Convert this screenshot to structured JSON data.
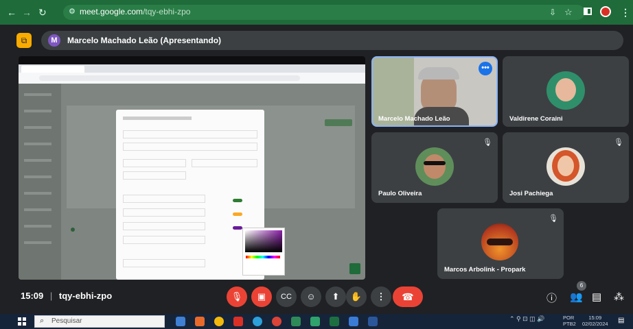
{
  "browser": {
    "url_host": "meet.google.com",
    "url_path": "/tqy-ebhi-zpo"
  },
  "header": {
    "presenter_initial": "M",
    "presenter_label": "Marcelo Machado Leão (Apresentando)"
  },
  "participants": [
    {
      "name": "Marcelo Machado Leão"
    },
    {
      "name": "Valdirene Coraini"
    },
    {
      "name": "Paulo Oliveira"
    },
    {
      "name": "Josi Pachiega"
    },
    {
      "name": "Marcos Arbolink - Propark"
    }
  ],
  "footer": {
    "time": "15:09",
    "separator": "|",
    "meeting_code": "tqy-ebhi-zpo",
    "participant_count": "6"
  },
  "taskbar": {
    "search_placeholder": "Pesquisar",
    "language": "POR",
    "language_sub": "PTB2",
    "clock_time": "15:09",
    "clock_date": "02/02/2024"
  },
  "colors": {
    "chrome_green": "#1f6b3a",
    "meet_bg": "#202124",
    "tile_bg": "#3c4043",
    "active_speaker": "#8ab4f8",
    "danger": "#ea4335",
    "presenting_accent": "#f9ab00"
  },
  "icons": [
    "back-icon",
    "forward-icon",
    "reload-icon",
    "site-info-icon",
    "extensions-icon",
    "star-icon",
    "side-panel-icon",
    "profile-icon",
    "more-icon",
    "present-icon",
    "mic-off-icon",
    "cam-off-icon",
    "captions-icon",
    "emoji-icon",
    "present-screen-icon",
    "raise-hand-icon",
    "more-options-icon",
    "end-call-icon",
    "info-icon",
    "people-icon",
    "chat-icon",
    "activities-icon",
    "windows-icon",
    "search-icon"
  ]
}
